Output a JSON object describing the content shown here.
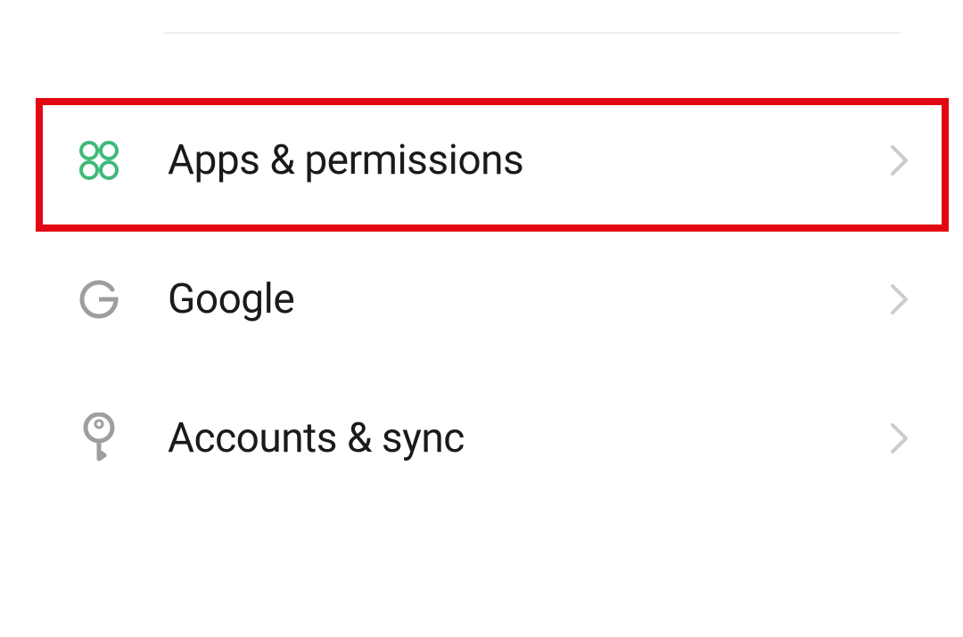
{
  "settings": {
    "items": [
      {
        "id": "apps-permissions",
        "label": "Apps & permissions",
        "icon": "apps-icon",
        "icon_color": "#3fba79",
        "highlighted": true
      },
      {
        "id": "google",
        "label": "Google",
        "icon": "google-icon",
        "icon_color": "#9e9e9e",
        "highlighted": false
      },
      {
        "id": "accounts-sync",
        "label": "Accounts & sync",
        "icon": "key-icon",
        "icon_color": "#9e9e9e",
        "highlighted": false
      }
    ]
  },
  "colors": {
    "highlight_border": "#e30613",
    "chevron": "#cccccc"
  }
}
